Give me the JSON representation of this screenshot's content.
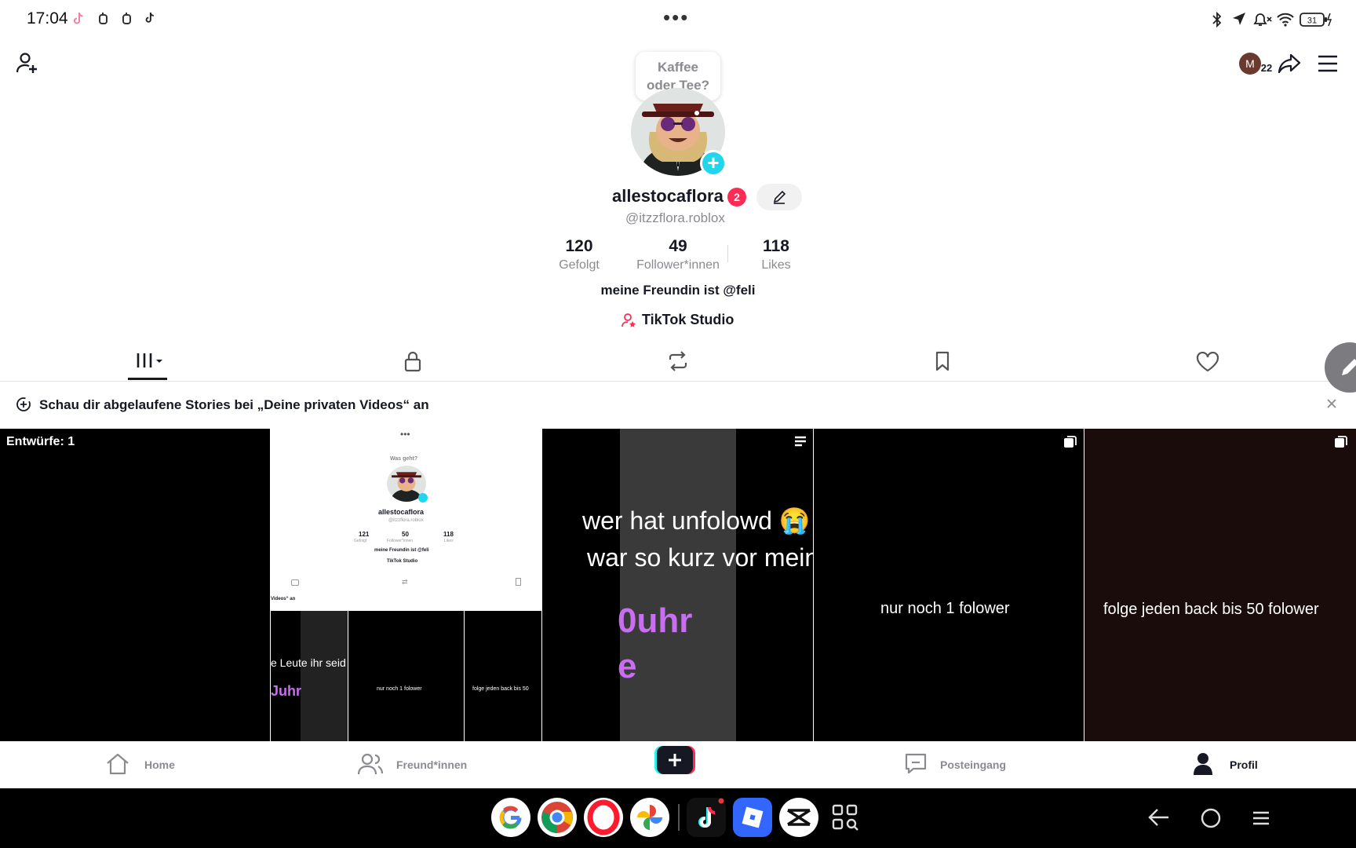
{
  "status_bar": {
    "time": "17:04",
    "battery": "31"
  },
  "header": {
    "speech_bubble": "Kaffee oder Tee?",
    "speech_line1": "Kaffee",
    "speech_line2": "oder Tee?",
    "friends_badge_letter": "M",
    "friends_badge_count": "22"
  },
  "profile": {
    "username": "allestocaflora",
    "badge_count": "2",
    "handle": "@itzzflora.roblox",
    "stats": [
      {
        "value": "120",
        "label": "Gefolgt"
      },
      {
        "value": "49",
        "label": "Follower*innen"
      },
      {
        "value": "118",
        "label": "Likes"
      }
    ],
    "bio": "meine Freundin ist @feli",
    "studio_link": "TikTok Studio"
  },
  "banner": {
    "text": "Schau dir abgelaufene Stories bei „Deine privaten Videos“ an"
  },
  "grid": {
    "drafts_label": "Entwürfe: 1",
    "video2": {
      "line1": "wer hat unfolowd 😭",
      "line2": "war so kurz vor meinem dream",
      "bg_text": "0uhr"
    },
    "video3": "nur noch 1 folower",
    "video4": "folge jeden back bis 50 folower",
    "mini": {
      "bubble": "Was geht?",
      "username": "allestocaflora",
      "handle": "@itzzflora.roblox",
      "stats": [
        {
          "value": "121",
          "label": "Gefolgt"
        },
        {
          "value": "50",
          "label": "Follower*innen"
        },
        {
          "value": "118",
          "label": "Likes"
        }
      ],
      "bio": "meine Freundin ist @feli",
      "studio": "TikTok Studio",
      "banner_tail": "Videos“ an",
      "cell1": "e Leute ihr seid die besten das speziell kommt morgen",
      "cell1_sub": "Juhr",
      "cell2": "nur noch 1 folower",
      "cell3": "folge jeden back bis 50"
    }
  },
  "bottom_nav": {
    "home": "Home",
    "friends": "Freund*innen",
    "inbox": "Posteingang",
    "profile": "Profil"
  },
  "colors": {
    "accent_pink": "#fe2c55",
    "accent_cyan": "#20d5ec",
    "text_primary": "#161823",
    "text_secondary": "#8a8b91"
  }
}
